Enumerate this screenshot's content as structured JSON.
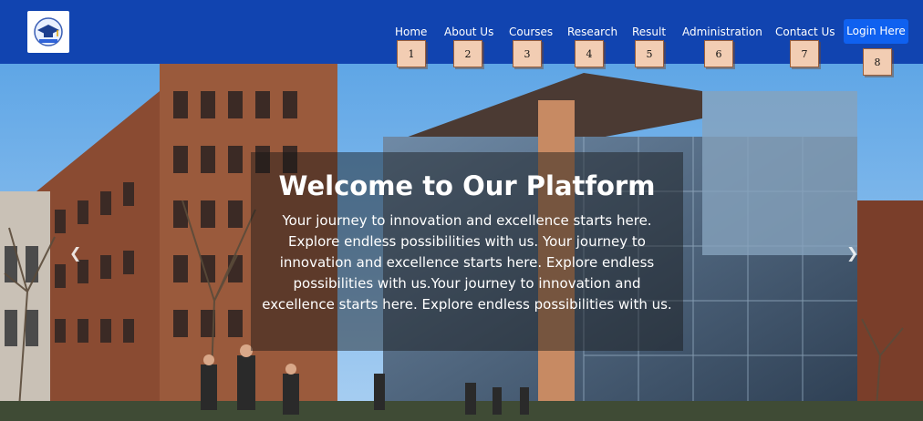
{
  "nav": {
    "items": [
      {
        "label": "Home",
        "tag": "1"
      },
      {
        "label": "About Us",
        "tag": "2"
      },
      {
        "label": "Courses",
        "tag": "3"
      },
      {
        "label": "Research",
        "tag": "4"
      },
      {
        "label": "Result",
        "tag": "5"
      },
      {
        "label": "Administration",
        "tag": "6"
      },
      {
        "label": "Contact Us",
        "tag": "7"
      }
    ],
    "login_label": "Login Here",
    "login_tag": "8"
  },
  "hero": {
    "title": "Welcome to Our Platform",
    "description": "Your journey to innovation and excellence starts here. Explore endless possibilities with us. Your journey to innovation and excellence starts here. Explore endless possibilities with us.Your journey to innovation and excellence starts here. Explore endless possibilities with us."
  },
  "colors": {
    "header_bg": "#1144b0",
    "login_bg": "#0f61f0",
    "tag_bg": "#f2cdb3"
  },
  "icons": {
    "logo": "graduation-cap-logo",
    "prev": "chevron-left-icon",
    "next": "chevron-right-icon"
  }
}
